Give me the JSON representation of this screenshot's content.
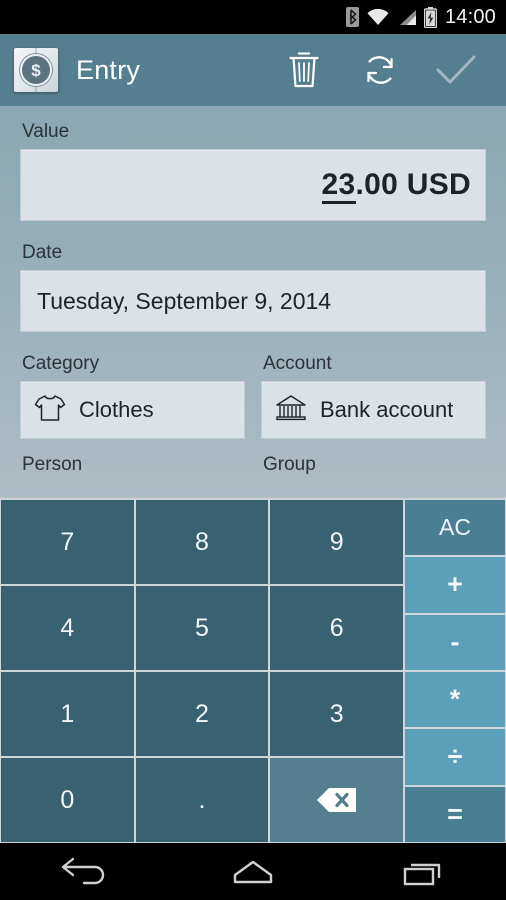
{
  "status_bar": {
    "time": "14:00",
    "icons": [
      "bluetooth-icon",
      "wifi-icon",
      "cellular-signal-icon",
      "battery-charging-icon"
    ]
  },
  "action_bar": {
    "app_icon": "money-book-icon",
    "app_icon_glyph": "$",
    "title": "Entry",
    "actions": [
      {
        "name": "delete-button",
        "icon": "trash-icon",
        "enabled": true
      },
      {
        "name": "refresh-button",
        "icon": "refresh-icon",
        "enabled": true
      },
      {
        "name": "confirm-button",
        "icon": "check-icon",
        "enabled": false
      }
    ]
  },
  "form": {
    "value": {
      "label": "Value",
      "amount_head": "23",
      "amount_tail": ".00 USD"
    },
    "date": {
      "label": "Date",
      "value": "Tuesday, September 9, 2014"
    },
    "category": {
      "label": "Category",
      "value": "Clothes",
      "icon": "tshirt-icon"
    },
    "account": {
      "label": "Account",
      "value": "Bank account",
      "icon": "bank-icon"
    },
    "person": {
      "label": "Person"
    },
    "group": {
      "label": "Group"
    }
  },
  "keypad": {
    "digits": [
      "7",
      "8",
      "9",
      "4",
      "5",
      "6",
      "1",
      "2",
      "3",
      "0",
      "."
    ],
    "backspace_icon": "backspace-icon",
    "ops": [
      {
        "label": "AC",
        "kind": "ac"
      },
      {
        "label": "+",
        "kind": "op"
      },
      {
        "label": "-",
        "kind": "op"
      },
      {
        "label": "*",
        "kind": "op"
      },
      {
        "label": "÷",
        "kind": "op"
      },
      {
        "label": "=",
        "kind": "eq"
      }
    ]
  },
  "nav_bar": {
    "buttons": [
      "back-button",
      "home-button",
      "recents-button"
    ]
  },
  "colors": {
    "action_bar": "#557e90",
    "key_digit": "#3a6172",
    "key_operator": "#5ba0b8",
    "key_accent": "#4a7f93",
    "input_field": "#dae1e7",
    "background_top": "#8aa7b3",
    "background_bottom": "#adbdc4"
  }
}
